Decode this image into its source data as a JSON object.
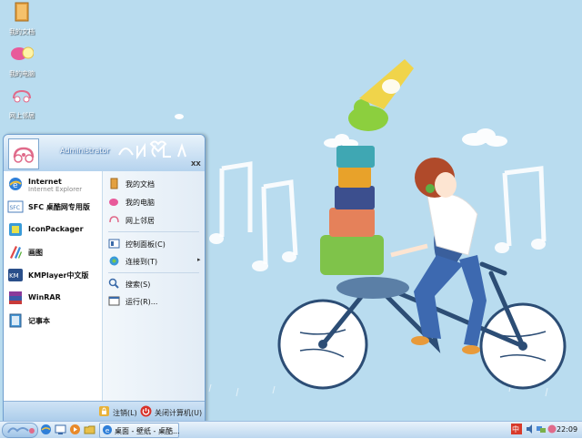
{
  "desktop": {
    "icons": [
      {
        "label": "我的文档",
        "icon": "folder-icon"
      },
      {
        "label": "我的电脑",
        "icon": "computer-icon"
      },
      {
        "label": "网上邻居",
        "icon": "network-icon"
      }
    ]
  },
  "start_menu": {
    "username": "Administrator",
    "close_label": "XX",
    "pinned": [
      {
        "title": "Internet",
        "subtitle": "Internet Explorer",
        "icon": "internet-explorer-icon"
      },
      {
        "title": "SFC 桌酷网专用版",
        "icon": "sfc-icon"
      },
      {
        "title": "IconPackager",
        "icon": "iconpackager-icon"
      },
      {
        "title": "画图",
        "icon": "paint-icon"
      },
      {
        "title": "KMPlayer中文版",
        "icon": "kmplayer-icon"
      },
      {
        "title": "WinRAR",
        "icon": "winrar-icon"
      },
      {
        "title": "记事本",
        "icon": "notepad-icon"
      }
    ],
    "places": [
      {
        "label": "我的文档",
        "icon": "documents-icon"
      },
      {
        "label": "我的电脑",
        "icon": "computer-icon"
      },
      {
        "label": "网上邻居",
        "icon": "network-icon"
      },
      {
        "label": "控制面板(C)",
        "icon": "control-panel-icon"
      },
      {
        "label": "连接到(T)",
        "icon": "connect-icon",
        "arrow": "▸"
      },
      {
        "label": "搜索(S)",
        "icon": "search-icon"
      },
      {
        "label": "运行(R)...",
        "icon": "run-icon"
      }
    ],
    "logoff_label": "注销(L)",
    "shutdown_label": "关闭计算机(U)"
  },
  "taskbar": {
    "task_label": "桌面 - 壁纸 - 桌酷...",
    "clock": "22:09",
    "tray_label": "中"
  },
  "colors": {
    "desktop_bg": "#b9dcef",
    "start_header": "#b5d3ee",
    "taskbar": "#bcd7ef",
    "shutdown_red": "#d8322a"
  }
}
